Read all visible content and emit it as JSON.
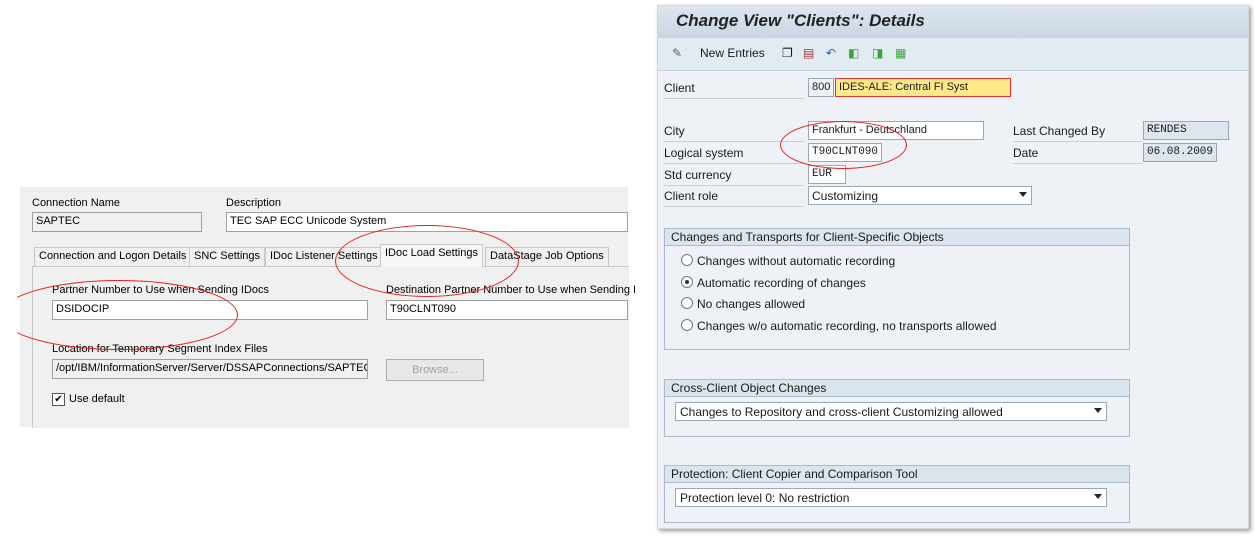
{
  "left_dialog": {
    "connection_name_label": "Connection Name",
    "connection_name": "SAPTEC",
    "description_label": "Description",
    "description": "TEC SAP ECC Unicode System",
    "tabs": [
      "Connection and Logon Details",
      "SNC Settings",
      "IDoc Listener Settings",
      "IDoc Load Settings",
      "DataStage Job Options"
    ],
    "active_tab": "IDoc Load Settings",
    "partner_label": "Partner Number to Use when Sending IDocs",
    "partner_value": "DSIDOCIP",
    "dest_partner_label": "Destination Partner Number to Use when Sending I",
    "dest_partner_value": "T90CLNT090",
    "location_label": "Location for Temporary Segment Index Files",
    "location_value": "/opt/IBM/InformationServer/Server/DSSAPConnections/SAPTEC",
    "browse_label": "Browse...",
    "use_default_label": "Use default",
    "use_default_checked": true
  },
  "sap": {
    "title": "Change View \"Clients\": Details",
    "toolbar": {
      "new_entries": "New Entries",
      "icons": [
        "display-change-icon",
        "copy-icon",
        "delete-icon",
        "undo-icon",
        "previous-entry-icon",
        "next-entry-icon",
        "select-all-icon"
      ]
    },
    "client_label": "Client",
    "client_number": "800",
    "client_name": "IDES-ALE: Central FI Syst",
    "city_label": "City",
    "city": "Frankfurt - Deutschland",
    "logical_system_label": "Logical system",
    "logical_system": "T90CLNT090",
    "currency_label": "Std currency",
    "currency": "EUR",
    "role_label": "Client role",
    "role": "Customizing",
    "last_changed_label": "Last Changed By",
    "last_changed": "RENDES",
    "date_label": "Date",
    "date": "06.08.2009",
    "group1": {
      "title": "Changes and Transports for Client-Specific Objects",
      "options": [
        "Changes without automatic recording",
        "Automatic recording of changes",
        "No changes allowed",
        "Changes w/o automatic recording, no transports allowed"
      ],
      "selected": 1
    },
    "group2": {
      "title": "Cross-Client Object Changes",
      "value": "Changes to Repository and cross-client Customizing allowed"
    },
    "group3": {
      "title": "Protection: Client Copier and Comparison Tool",
      "value": "Protection level 0: No restriction"
    },
    "highlight_color": "#fde98a",
    "annotation_color": "#e02020"
  }
}
